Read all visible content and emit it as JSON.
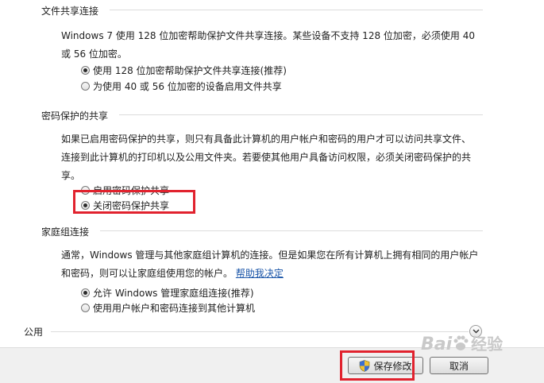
{
  "file_sharing": {
    "title": "文件共享连接",
    "description_line1": "Windows 7 使用 128 位加密帮助保护文件共享连接。某些设备不支持 128 位加密，必须使用 40",
    "description_line2": "或 56 位加密。",
    "options": [
      {
        "label": "使用 128 位加密帮助保护文件共享连接(推荐)",
        "checked": true
      },
      {
        "label": "为使用 40 或 56 位加密的设备启用文件共享",
        "checked": false
      }
    ]
  },
  "password_sharing": {
    "title": "密码保护的共享",
    "description_line1": "如果已启用密码保护的共享，则只有具备此计算机的用户帐户和密码的用户才可以访问共享文件、",
    "description_line2": "连接到此计算机的打印机以及公用文件夹。若要使其他用户具备访问权限，必须关闭密码保护的共",
    "description_line3": "享。",
    "options": [
      {
        "label": "启用密码保护共享",
        "checked": false
      },
      {
        "label": "关闭密码保护共享",
        "checked": true
      }
    ]
  },
  "homegroup": {
    "title": "家庭组连接",
    "description_line1": "通常，Windows 管理与其他家庭组计算机的连接。但是如果您在所有计算机上拥有相同的用户帐户",
    "description_line2": "和密码，则可以让家庭组使用您的帐户。",
    "help_link": "帮助我决定",
    "options": [
      {
        "label": "允许 Windows 管理家庭组连接(推荐)",
        "checked": true
      },
      {
        "label": "使用用户帐户和密码连接到其他计算机",
        "checked": false
      }
    ]
  },
  "public": {
    "title": "公用"
  },
  "buttons": {
    "save": "保存修改",
    "cancel": "取消"
  },
  "watermark": {
    "brand": "Bai",
    "suffix": "经验"
  },
  "colors": {
    "highlight": "#e1222e",
    "link": "#1a55a8"
  }
}
